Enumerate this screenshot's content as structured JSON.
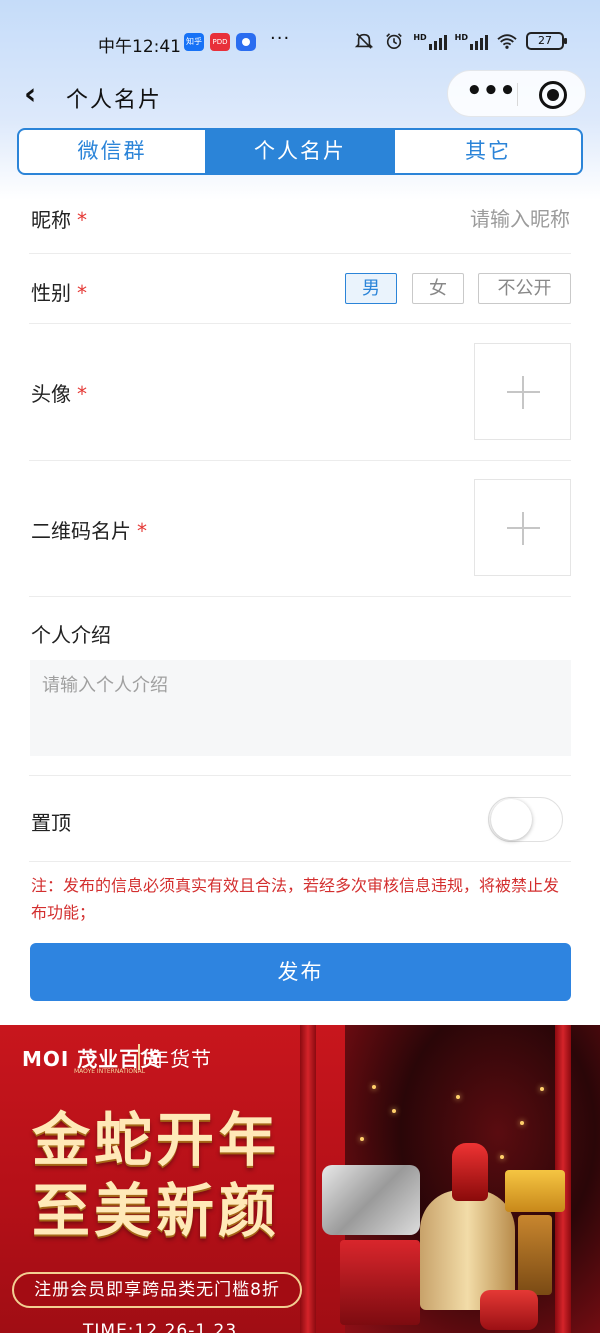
{
  "status_bar": {
    "time": "中午12:41",
    "app_icons": [
      {
        "name": "zhihu-icon",
        "label": "知乎"
      },
      {
        "name": "pinduoduo-icon",
        "label": "PDD"
      },
      {
        "name": "app-icon",
        "label": ""
      }
    ],
    "more": "···",
    "hd1": "HD",
    "hd2": "HD",
    "battery": "27"
  },
  "nav": {
    "back_icon": "‹",
    "title": "个人名片",
    "more_icon": "•••"
  },
  "tabs": [
    {
      "label": "微信群",
      "active": false
    },
    {
      "label": "个人名片",
      "active": true
    },
    {
      "label": "其它",
      "active": false
    }
  ],
  "form": {
    "nickname": {
      "label": "昵称",
      "required_mark": "*",
      "value": "",
      "placeholder": "请输入昵称"
    },
    "gender": {
      "label": "性别",
      "required_mark": "*",
      "options": [
        "男",
        "女",
        "不公开"
      ],
      "selected": "男"
    },
    "avatar": {
      "label": "头像",
      "required_mark": "*"
    },
    "qrcode": {
      "label": "二维码名片",
      "required_mark": "*"
    },
    "intro": {
      "label": "个人介绍",
      "value": "",
      "placeholder": "请输入个人介绍"
    },
    "pin_top": {
      "label": "置顶",
      "enabled": false
    },
    "notice": "注：发布的信息必须真实有效且合法，若经多次审核信息违规，将被禁止发布功能；",
    "submit_label": "发布"
  },
  "banner": {
    "logo": "MOI 茂业百货",
    "logo_sub": "MAOYE INTERNATIONAL",
    "festival": "年货节",
    "headline_1": "金蛇开年",
    "headline_2": "至美新颜",
    "promo": "注册会员即享跨品类无门槛8折",
    "time": "TIME:12.26-1.23"
  },
  "colors": {
    "accent": "#2b84d8",
    "publish_button": "#2e84e0",
    "required": "#e53935",
    "notice": "#d32f2f",
    "banner_red": "#c8161d"
  }
}
